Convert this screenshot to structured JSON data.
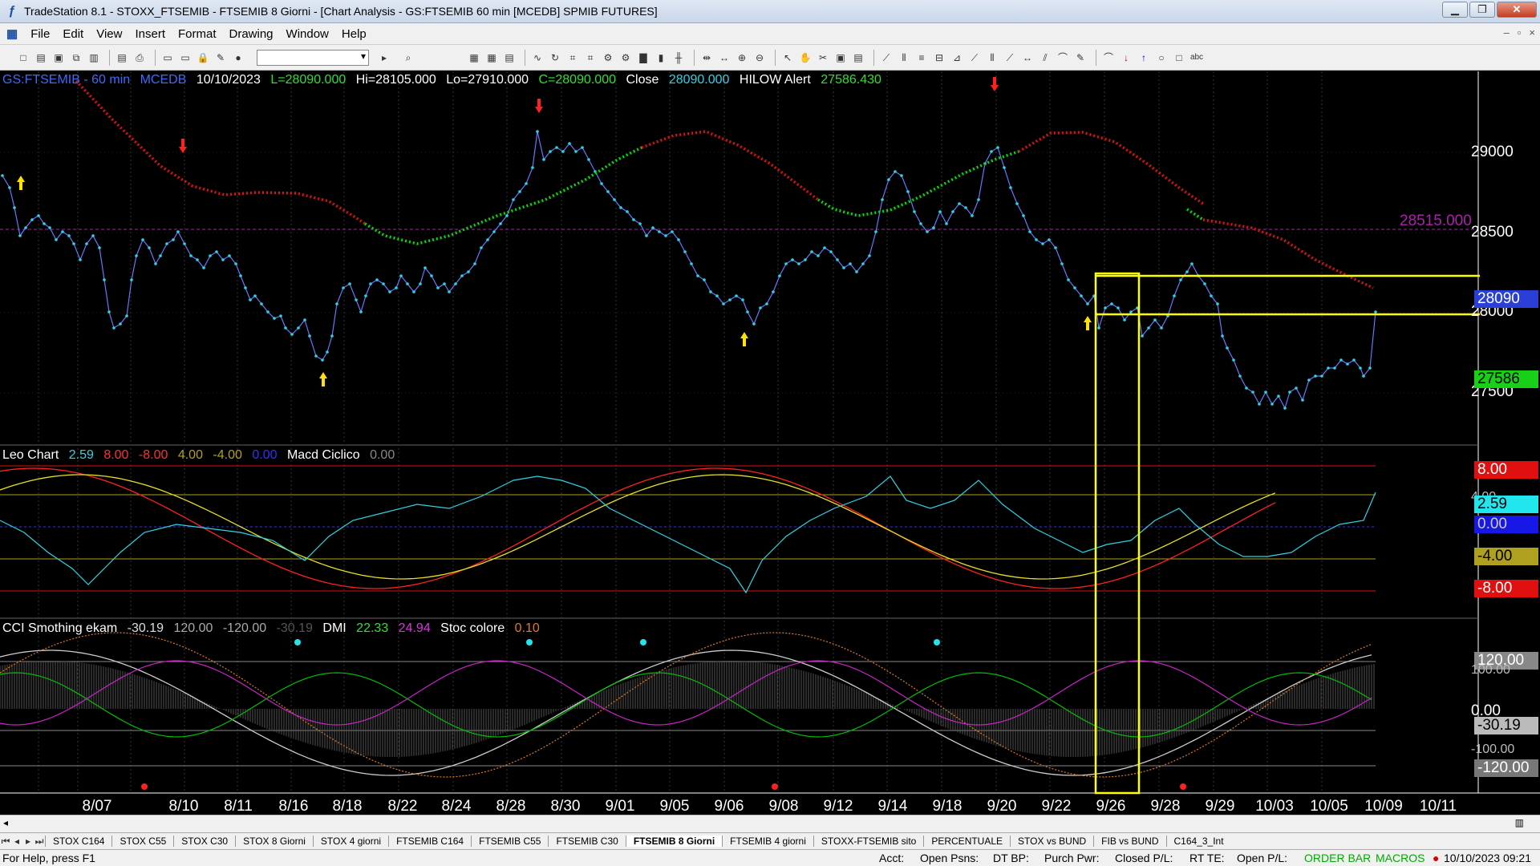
{
  "window": {
    "title": "TradeStation 8.1 - STOXX_FTSEMIB - FTSEMIB  8 Giorni - [Chart Analysis - GS:FTSEMIB  60 min  [MCEDB] SPMIB FUTURES]"
  },
  "menu": [
    "File",
    "Edit",
    "View",
    "Insert",
    "Format",
    "Drawing",
    "Window",
    "Help"
  ],
  "price_header": {
    "symbol": "GS:FTSEMIB - 60 min",
    "feed": "MCEDB",
    "date": "10/10/2023",
    "last": "L=28090.000",
    "high": "Hi=28105.000",
    "low": "Lo=27910.000",
    "close": "C=28090.000",
    "close_label": "Close",
    "close_value": "28090.000",
    "alert_label": "HILOW Alert",
    "alert_value": "27586.430"
  },
  "leo_header": {
    "name": "Leo Chart",
    "v1": "2.59",
    "v2": "8.00",
    "v3": "-8.00",
    "v4": "4.00",
    "v5": "-4.00",
    "v6": "0.00",
    "macd_label": "Macd Ciclico",
    "macd_value": "0.00"
  },
  "cci_header": {
    "name": "CCI Smothing ekam",
    "v1": "-30.19",
    "v2": "120.00",
    "v3": "-120.00",
    "v4": "-30.19",
    "dmi_label": "DMI",
    "dmi1": "22.33",
    "dmi2": "24.94",
    "stoc_label": "Stoc colore",
    "stoc_value": "0.10"
  },
  "price_axis": [
    "29000",
    "28500",
    "28000",
    "27500"
  ],
  "price_tags": {
    "level": "28515.000",
    "last": "28090",
    "alert": "27586"
  },
  "leo_axis": {
    "top": "8.00",
    "upper": "4.00",
    "cur": "2.59",
    "zero": "0.00",
    "lower": "-4.00",
    "bottom": "-8.00"
  },
  "cci_axis": {
    "top": "120.00",
    "upper": "100.00",
    "zero": "0.00",
    "cur": "-30.19",
    "lower": "-100.00",
    "bottom": "-120.00"
  },
  "x_ticks": [
    "8/07",
    "8/10",
    "8/11",
    "8/16",
    "8/18",
    "8/22",
    "8/24",
    "8/28",
    "8/30",
    "9/01",
    "9/05",
    "9/06",
    "9/08",
    "9/12",
    "9/14",
    "9/18",
    "9/20",
    "9/22",
    "9/26",
    "9/28",
    "9/29",
    "10/03",
    "10/05",
    "10/09",
    "10/11"
  ],
  "tabs": [
    "STOX C164",
    "STOX C55",
    "STOX  C30",
    "STOX  8 Giorni",
    "STOX 4 giorni",
    "FTSEMIB C164",
    "FTSEMIB C55",
    "FTSEMIB C30",
    "FTSEMIB  8 Giorni",
    "FTSEMIB  4 giorni",
    "STOXX-FTSEMIB sito",
    "PERCENTUALE",
    "STOX vs BUND",
    "FIB vs BUND",
    "C164_3_Int"
  ],
  "status": {
    "help": "For Help, press F1",
    "acct": "Acct:",
    "open_psns": "Open Psns:",
    "dt_bp": "DT BP:",
    "purch_pwr": "Purch Pwr:",
    "closed_pl": "Closed P/L:",
    "rt_te": "RT TE:",
    "open_pl": "Open P/L:",
    "order_bar": "ORDER BAR",
    "macros": "MACROS",
    "datetime": "10/10/2023 09:21"
  },
  "colors": {
    "price": "#2fd3e6",
    "ma_up": "#00e000",
    "ma_down": "#e01010",
    "highlight": "#ffff00",
    "dmi_plus": "#00c000",
    "dmi_minus": "#cc22cc"
  }
}
